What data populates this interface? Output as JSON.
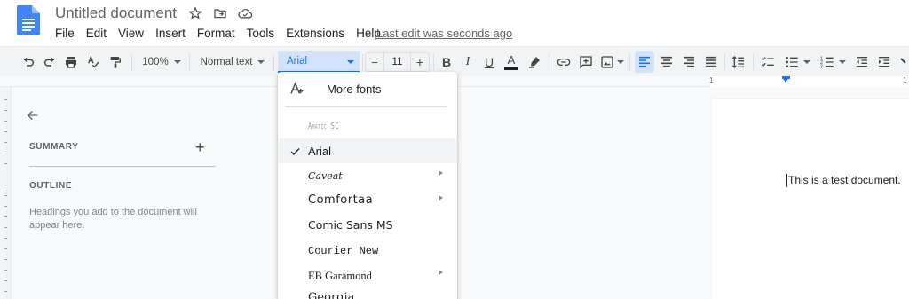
{
  "document": {
    "title": "Untitled document",
    "last_edit": "Last edit was seconds ago"
  },
  "menubar": [
    "File",
    "Edit",
    "View",
    "Insert",
    "Format",
    "Tools",
    "Extensions",
    "Help"
  ],
  "toolbar": {
    "zoom": "100%",
    "style": "Normal text",
    "font": "Arial",
    "font_size": "11",
    "minus": "−",
    "plus": "+",
    "bold": "B",
    "italic": "I",
    "underline": "U",
    "text_color": "A"
  },
  "sidebar": {
    "summary_label": "SUMMARY",
    "summary_add": "+",
    "outline_label": "OUTLINE",
    "outline_help": "Headings you add to the document will appear here."
  },
  "ruler": {
    "label_left": "1",
    "label_right": "1"
  },
  "page": {
    "text": "This is a test document."
  },
  "font_menu": {
    "more_fonts": "More fonts",
    "items": [
      {
        "name": "Amatic SC",
        "selected": false,
        "submenu": false
      },
      {
        "name": "Arial",
        "selected": true,
        "submenu": false
      },
      {
        "name": "Caveat",
        "selected": false,
        "submenu": true
      },
      {
        "name": "Comfortaa",
        "selected": false,
        "submenu": true
      },
      {
        "name": "Comic Sans MS",
        "selected": false,
        "submenu": false
      },
      {
        "name": "Courier New",
        "selected": false,
        "submenu": false
      },
      {
        "name": "EB Garamond",
        "selected": false,
        "submenu": true
      },
      {
        "name": "Georgia",
        "selected": false,
        "submenu": false
      }
    ]
  },
  "colors": {
    "accent": "#1a73e8",
    "accent_bg": "#d3e3fd",
    "docs_blue": "#4285f4"
  }
}
